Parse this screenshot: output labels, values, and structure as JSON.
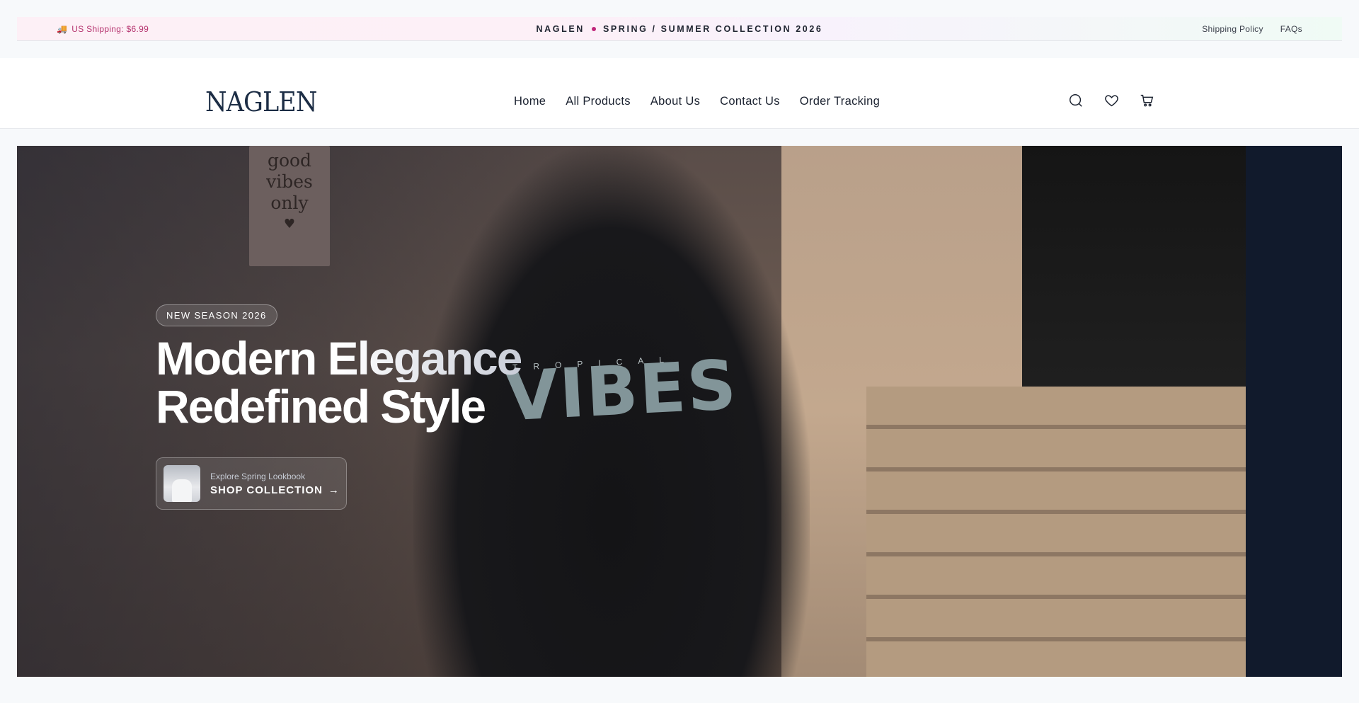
{
  "announcement": {
    "shipping": "US Shipping: $6.99",
    "brand": "NAGLEN",
    "collection": "SPRING / SUMMER COLLECTION 2026",
    "links": [
      "Shipping Policy",
      "FAQs"
    ]
  },
  "header": {
    "logo": "NAGLEN",
    "nav": [
      "Home",
      "All Products",
      "About Us",
      "Contact Us",
      "Order Tracking"
    ],
    "icons": [
      "search-icon",
      "heart-icon",
      "cart-icon"
    ]
  },
  "hero": {
    "badge": "NEW SEASON 2026",
    "headline_line1": "Modern Elegance",
    "headline_line2": "Redefined Style",
    "cta_sub": "Explore Spring Lookbook",
    "cta_main": "SHOP COLLECTION",
    "cta_arrow": "→",
    "image_text": {
      "sign": [
        "good",
        "vibes",
        "only",
        "♥"
      ],
      "shirt_small": "TROPICAL",
      "shirt_big": "VIBES"
    }
  },
  "colors": {
    "accent": "#c0267a",
    "shipping_text": "#b6346f",
    "logo": "#1c2d45",
    "hero_bg": "#111a2c"
  }
}
